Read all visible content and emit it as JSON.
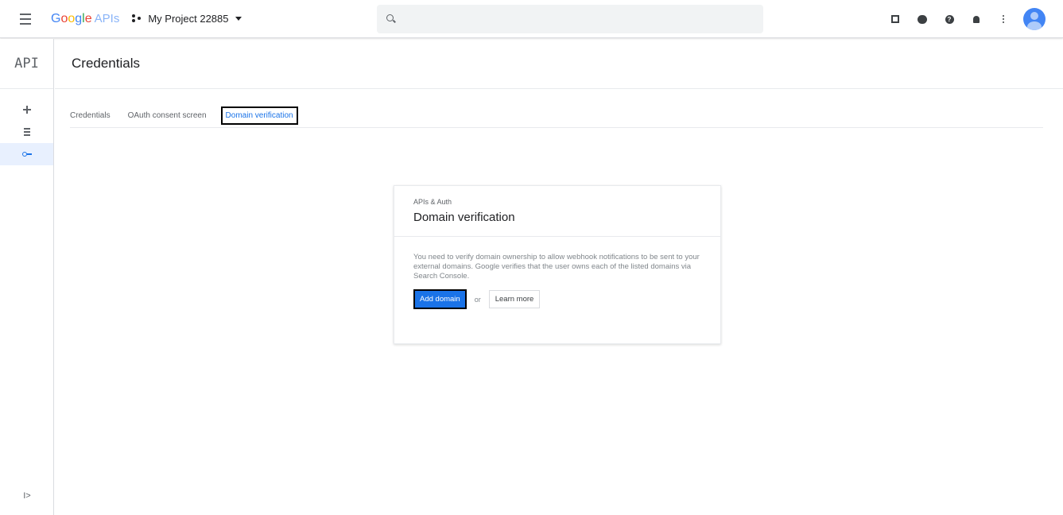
{
  "topbar": {
    "logo_google": [
      "G",
      "o",
      "o",
      "g",
      "l",
      "e"
    ],
    "logo_apis": "APIs",
    "project_name": "My Project 22885",
    "search_placeholder": ""
  },
  "rail": {
    "title": "API",
    "items": [
      {
        "icon": "dashboard-icon",
        "active": false
      },
      {
        "icon": "library-icon",
        "active": false
      },
      {
        "icon": "key-icon",
        "active": true
      }
    ],
    "expand_glyph": "I>"
  },
  "page": {
    "title": "Credentials"
  },
  "tabs": [
    {
      "label": "Credentials",
      "active": false
    },
    {
      "label": "OAuth consent screen",
      "active": false
    },
    {
      "label": "Domain verification",
      "active": true
    }
  ],
  "card": {
    "eyebrow": "APIs & Auth",
    "title": "Domain verification",
    "description": "You need to verify domain ownership to allow webhook notifications to be sent to your external domains. Google verifies that the user owns each of the listed domains via Search Console.",
    "primary_button": "Add domain",
    "or_text": "or",
    "secondary_button": "Learn more"
  },
  "colors": {
    "accent": "#1a73e8",
    "active_rail_bg": "#e8f0fe"
  }
}
